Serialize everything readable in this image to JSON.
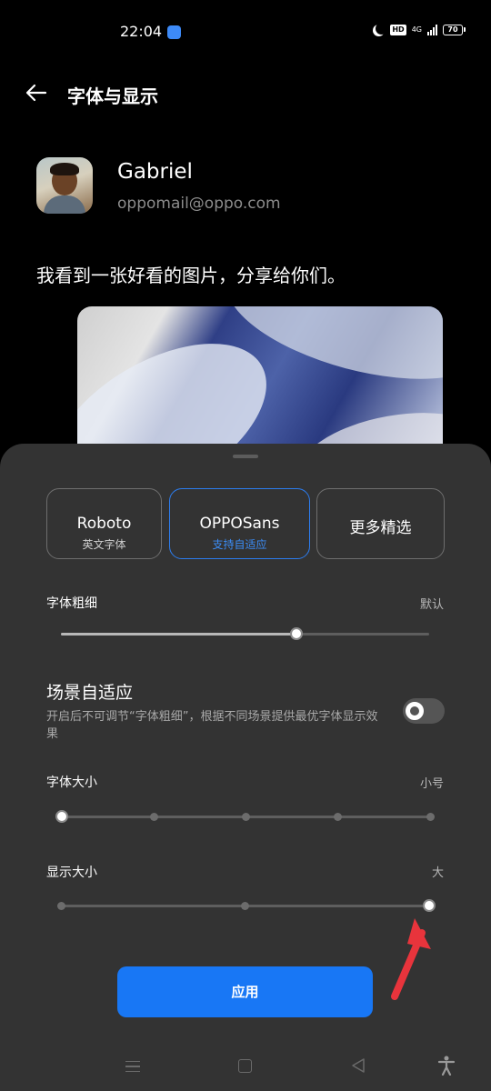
{
  "status_bar": {
    "time": "22:04",
    "network": "4G",
    "hd_label": "HD",
    "battery": "70"
  },
  "header": {
    "title": "字体与显示",
    "back_icon": "arrow-left-icon"
  },
  "preview": {
    "name": "Gabriel",
    "email": "oppomail@oppo.com",
    "message": "我看到一张好看的图片，分享给你们。"
  },
  "font_options": [
    {
      "label": "Roboto",
      "sub": "英文字体",
      "selected": false
    },
    {
      "label": "OPPOSans",
      "sub": "支持自适应",
      "selected": true
    },
    {
      "label": "更多精选",
      "sub": "",
      "selected": false
    }
  ],
  "font_weight": {
    "label": "字体粗细",
    "value": "默认",
    "level": 0.64
  },
  "adaptive": {
    "title": "场景自适应",
    "description": "开启后不可调节“字体粗细”，根据不同场景提供最优字体显示效果",
    "enabled": false
  },
  "font_size": {
    "label": "字体大小",
    "value": "小号",
    "steps": 5,
    "selected_index": 0
  },
  "display_size": {
    "label": "显示大小",
    "value": "大",
    "steps": 3,
    "selected_index": 2
  },
  "apply_button": "应用",
  "colors": {
    "accent": "#1877f5",
    "sheet_bg": "#333333",
    "annotation_arrow": "#e8343c"
  },
  "nav_icons": [
    "menu-icon",
    "home-icon",
    "back-triangle-icon",
    "accessibility-icon"
  ]
}
